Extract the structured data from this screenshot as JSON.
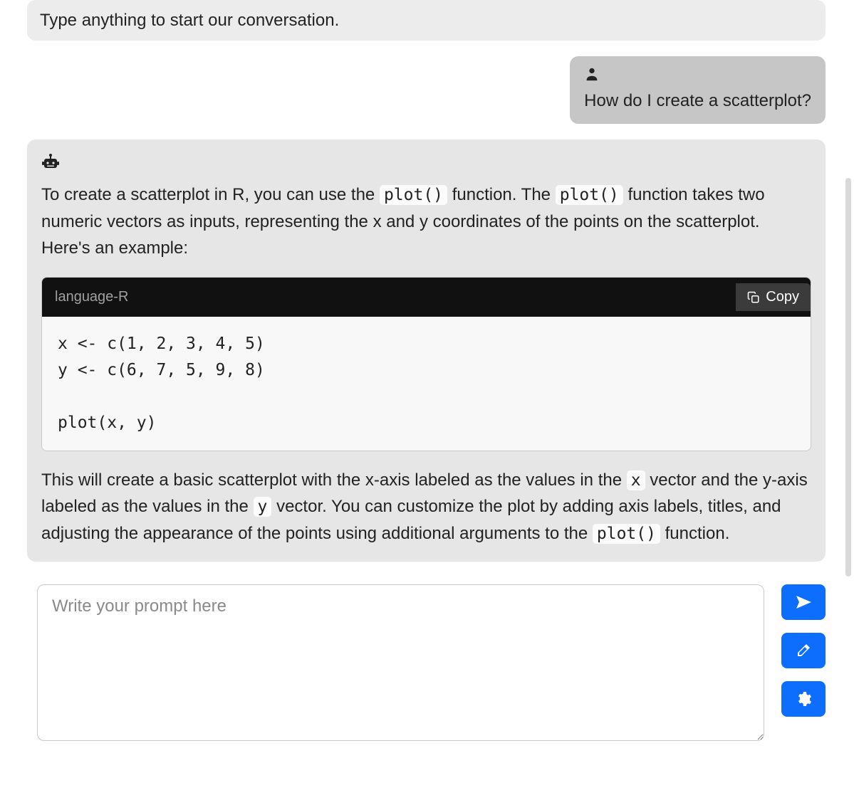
{
  "greeting": {
    "text": "Type anything to start our conversation."
  },
  "user_message": {
    "text": "How do I create a scatterplot?"
  },
  "assistant_message": {
    "intro_before_code1": "To create a scatterplot in R, you can use the ",
    "code1": "plot()",
    "intro_mid1": " function. The ",
    "code2": "plot()",
    "intro_after": " function takes two numeric vectors as inputs, representing the x and y coordinates of the points on the scatterplot. Here's an example:",
    "code_lang_label": "language-R",
    "copy_label": "Copy",
    "code_block": "x <- c(1, 2, 3, 4, 5)\ny <- c(6, 7, 5, 9, 8)\n\nplot(x, y)",
    "outro_before_x": "This will create a basic scatterplot with the x-axis labeled as the values in the ",
    "code_x": "x",
    "outro_mid1": " vector and the y-axis labeled as the values in the ",
    "code_y": "y",
    "outro_mid2": " vector. You can customize the plot by adding axis labels, titles, and adjusting the appearance of the points using additional arguments to the ",
    "code3": "plot()",
    "outro_end": " function."
  },
  "input": {
    "placeholder": "Write your prompt here"
  }
}
